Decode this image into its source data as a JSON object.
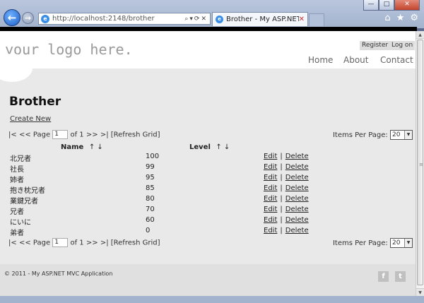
{
  "browser": {
    "url": "http://localhost:2148/brother",
    "url_display": "http://localhost:2148/brother",
    "tab_title": "Brother - My ASP.NET M...",
    "window_buttons": [
      "—",
      "□",
      "✕"
    ]
  },
  "header": {
    "logo": "your logo here.",
    "register": "Register",
    "logon": "Log on",
    "menu": [
      "Home",
      "About",
      "Contact"
    ]
  },
  "page": {
    "title": "Brother",
    "create_new": "Create New"
  },
  "pager": {
    "first": "|<",
    "prev": "<<",
    "page_label": "Page",
    "page_value": "1",
    "of_label": "of 1",
    "next": ">>",
    "last": ">|",
    "refresh": "[Refresh Grid]",
    "items_per_page_label": "Items Per Page:",
    "items_per_page_value": "20"
  },
  "table": {
    "columns": {
      "name": "Name",
      "level": "Level"
    },
    "sort_arrows": "↑ ↓",
    "edit_label": "Edit",
    "delete_label": "Delete",
    "separator": "|",
    "rows": [
      {
        "name": "北兄者",
        "level": "100"
      },
      {
        "name": "社長",
        "level": "99"
      },
      {
        "name": "姉者",
        "level": "95"
      },
      {
        "name": "抱き枕兄者",
        "level": "85"
      },
      {
        "name": "業鍵兄者",
        "level": "80"
      },
      {
        "name": "兄者",
        "level": "70"
      },
      {
        "name": "にいに",
        "level": "60"
      },
      {
        "name": "弟者",
        "level": "0"
      }
    ]
  },
  "footer": {
    "text": "© 2011 - My ASP.NET MVC Application",
    "facebook": "f",
    "twitter": "t"
  }
}
